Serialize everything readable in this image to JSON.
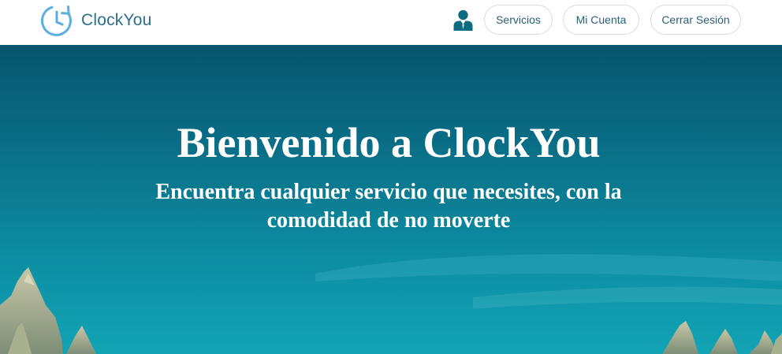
{
  "navbar": {
    "brand_name": "ClockYou",
    "buttons": {
      "servicios": "Servicios",
      "mi_cuenta": "Mi Cuenta",
      "cerrar_sesion": "Cerrar Sesión"
    }
  },
  "hero": {
    "title": "Bienvenido a ClockYou",
    "subtitle": "Encuentra cualquier servicio que necesites, con la comodidad de no moverte"
  },
  "icons": {
    "brand": "clock-refresh-icon",
    "user": "user-suit-icon"
  },
  "colors": {
    "brand_blue": "#5aaee0",
    "nav_text": "#2b5f76",
    "hero_top": "#07566e",
    "hero_bottom": "#10a2b3",
    "user_icon": "#0e6b80"
  }
}
